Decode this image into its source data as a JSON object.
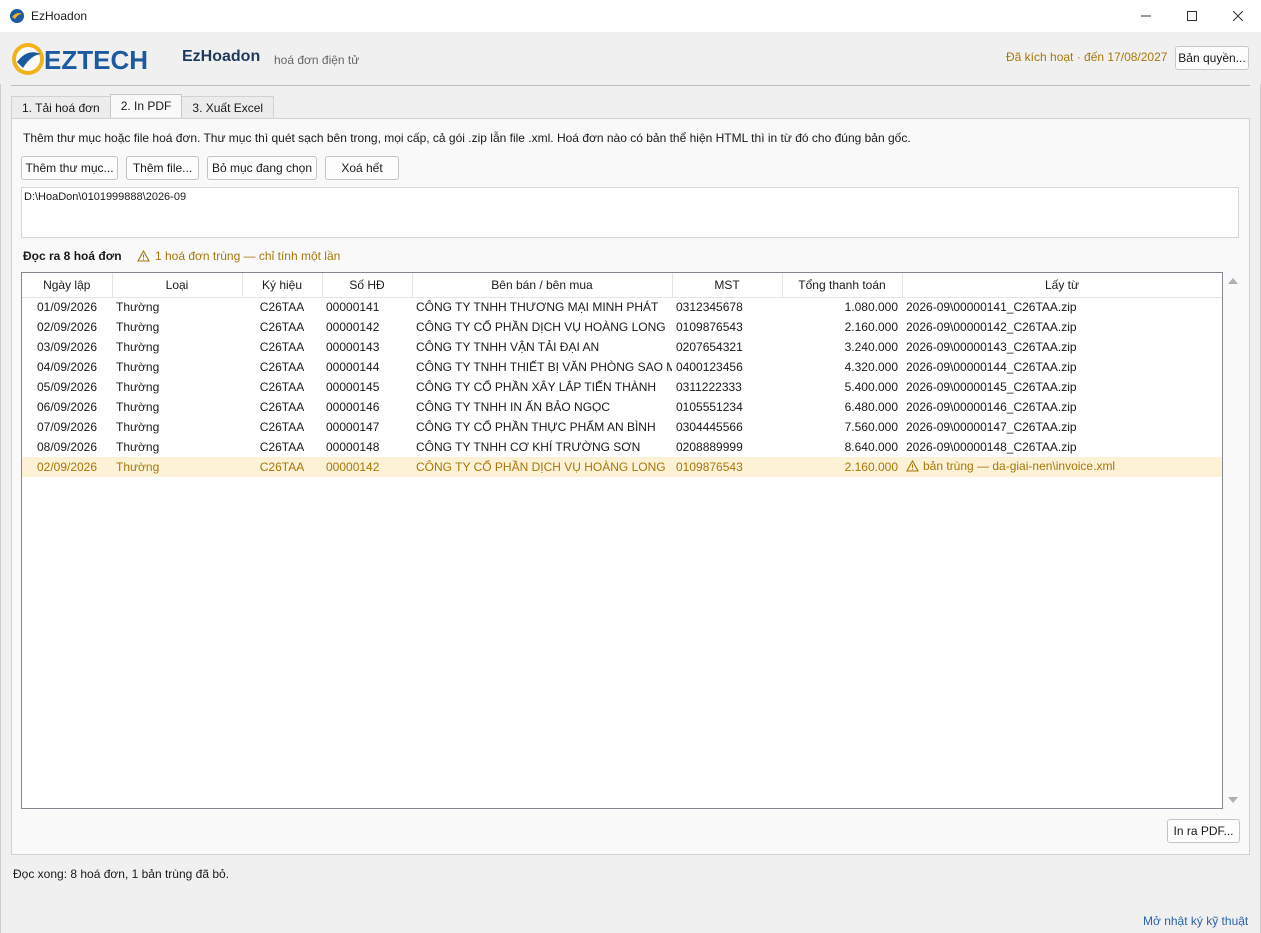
{
  "window": {
    "title": "EzHoadon",
    "icon": "app-logo-icon"
  },
  "header": {
    "logo_text": "EZTECH",
    "app_name": "EzHoadon",
    "app_subtitle": "hoá đơn điện tử",
    "license_status": "Đã kích hoạt · đến 17/08/2027",
    "license_button": "Bản quyền...",
    "colors": {
      "brand_blue": "#1c5aa0",
      "brand_gold": "#f2b21b",
      "status_gold": "#a7770a"
    }
  },
  "tabs": [
    {
      "label": "1. Tải hoá đơn",
      "active": false
    },
    {
      "label": "2. In PDF",
      "active": true
    },
    {
      "label": "3. Xuất Excel",
      "active": false
    }
  ],
  "panel": {
    "intro": "Thêm thư mục hoặc file hoá đơn. Thư mục thì quét sạch bên trong, mọi cấp, cả gói .zip lẫn file .xml. Hoá đơn nào có bản thể hiện HTML thì in từ đó cho đúng bản gốc.",
    "buttons": {
      "add_folder": "Thêm thư mục...",
      "add_file": "Thêm file...",
      "remove_selected": "Bỏ mục đang chọn",
      "clear_all": "Xoá hết"
    },
    "paths": [
      "D:\\HoaDon\\0101999888\\2026-09"
    ],
    "found_count": "Đọc ra 8 hoá đơn",
    "duplicate_notice": "1 hoá đơn trùng — chỉ tính một lần",
    "print_button": "In ra PDF..."
  },
  "table": {
    "columns": [
      "Ngày lập",
      "Loại",
      "Ký hiệu",
      "Số HĐ",
      "Bên bán / bên mua",
      "MST",
      "Tổng thanh toán",
      "Lấy từ"
    ],
    "rows": [
      {
        "date": "01/09/2026",
        "type": "Thường",
        "symbol": "C26TAA",
        "number": "00000141",
        "party": "CÔNG TY TNHH THƯƠNG MẠI MINH PHÁT",
        "tax": "0312345678",
        "total": "1.080.000",
        "source": "2026-09\\00000141_C26TAA.zip",
        "duplicate": false
      },
      {
        "date": "02/09/2026",
        "type": "Thường",
        "symbol": "C26TAA",
        "number": "00000142",
        "party": "CÔNG TY CỔ PHẦN DỊCH VỤ HOÀNG LONG",
        "tax": "0109876543",
        "total": "2.160.000",
        "source": "2026-09\\00000142_C26TAA.zip",
        "duplicate": false
      },
      {
        "date": "03/09/2026",
        "type": "Thường",
        "symbol": "C26TAA",
        "number": "00000143",
        "party": "CÔNG TY TNHH VẬN TẢI ĐẠI AN",
        "tax": "0207654321",
        "total": "3.240.000",
        "source": "2026-09\\00000143_C26TAA.zip",
        "duplicate": false
      },
      {
        "date": "04/09/2026",
        "type": "Thường",
        "symbol": "C26TAA",
        "number": "00000144",
        "party": "CÔNG TY TNHH THIẾT BỊ VĂN PHÒNG SAO MA",
        "tax": "0400123456",
        "total": "4.320.000",
        "source": "2026-09\\00000144_C26TAA.zip",
        "duplicate": false
      },
      {
        "date": "05/09/2026",
        "type": "Thường",
        "symbol": "C26TAA",
        "number": "00000145",
        "party": "CÔNG TY CỔ PHẦN XÂY LẮP TIẾN THÀNH",
        "tax": "0311222333",
        "total": "5.400.000",
        "source": "2026-09\\00000145_C26TAA.zip",
        "duplicate": false
      },
      {
        "date": "06/09/2026",
        "type": "Thường",
        "symbol": "C26TAA",
        "number": "00000146",
        "party": "CÔNG TY TNHH IN ẤN BẢO NGỌC",
        "tax": "0105551234",
        "total": "6.480.000",
        "source": "2026-09\\00000146_C26TAA.zip",
        "duplicate": false
      },
      {
        "date": "07/09/2026",
        "type": "Thường",
        "symbol": "C26TAA",
        "number": "00000147",
        "party": "CÔNG TY CỔ PHẦN THỰC PHẨM AN BÌNH",
        "tax": "0304445566",
        "total": "7.560.000",
        "source": "2026-09\\00000147_C26TAA.zip",
        "duplicate": false
      },
      {
        "date": "08/09/2026",
        "type": "Thường",
        "symbol": "C26TAA",
        "number": "00000148",
        "party": "CÔNG TY TNHH CƠ KHÍ TRƯỜNG SƠN",
        "tax": "0208889999",
        "total": "8.640.000",
        "source": "2026-09\\00000148_C26TAA.zip",
        "duplicate": false
      },
      {
        "date": "02/09/2026",
        "type": "Thường",
        "symbol": "C26TAA",
        "number": "00000142",
        "party": "CÔNG TY CỔ PHẦN DỊCH VỤ HOÀNG LONG",
        "tax": "0109876543",
        "total": "2.160.000",
        "source": "bản trùng — da-giai-nen\\invoice.xml",
        "duplicate": true
      }
    ]
  },
  "status": {
    "message": "Đọc xong: 8 hoá đơn, 1 bản trùng đã bỏ.",
    "log_link": "Mở nhật ký kỹ thuật"
  }
}
